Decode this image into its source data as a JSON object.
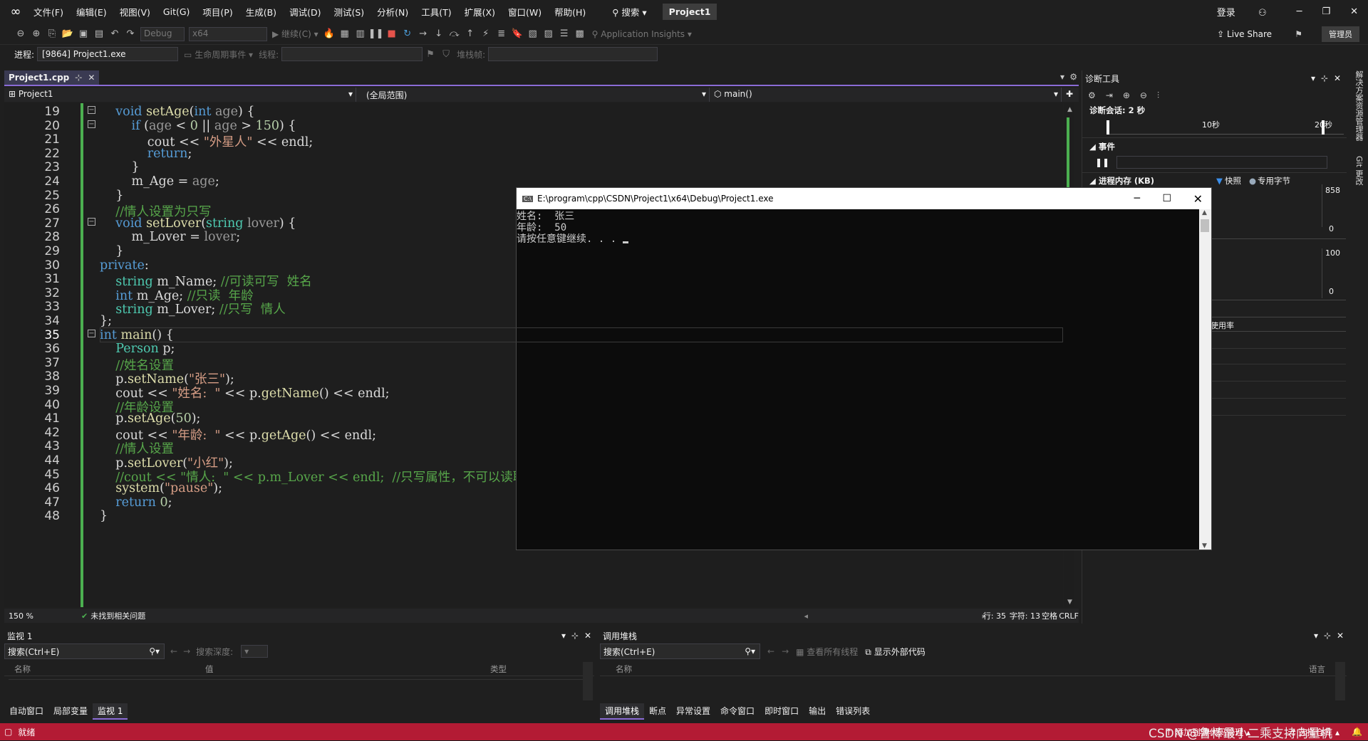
{
  "menubar": {
    "items": [
      "文件(F)",
      "编辑(E)",
      "视图(V)",
      "Git(G)",
      "项目(P)",
      "生成(B)",
      "调试(D)",
      "测试(S)",
      "分析(N)",
      "工具(T)",
      "扩展(X)",
      "窗口(W)",
      "帮助(H)"
    ],
    "search": "搜索",
    "project": "Project1",
    "signin": "登录",
    "admin": "管理员",
    "liveshare": "Live Share"
  },
  "toolbar": {
    "config": "Debug",
    "platform": "x64",
    "continue": "继续(C)",
    "insights": "Application Insights",
    "process_label": "进程:",
    "process_value": "[9864] Project1.exe",
    "lifecycle": "生命周期事件",
    "thread_label": "线程:",
    "stackframe_label": "堆栈帧:"
  },
  "editor": {
    "tab": "Project1.cpp",
    "nav_project": "Project1",
    "nav_scope": "(全局范围)",
    "nav_member": "main()",
    "zoom": "150 %",
    "issues": "未找到相关问题",
    "line_info": "行: 35",
    "char_info": "字符: 13",
    "spaces": "空格",
    "eol": "CRLF",
    "lines": [
      {
        "n": "19",
        "t": "    void setAge(int age) {"
      },
      {
        "n": "20",
        "t": "        if (age < 0 || age > 150) {"
      },
      {
        "n": "21",
        "t": "            cout << \"外星人\" << endl;"
      },
      {
        "n": "22",
        "t": "            return;"
      },
      {
        "n": "23",
        "t": "        }"
      },
      {
        "n": "24",
        "t": "        m_Age = age;"
      },
      {
        "n": "25",
        "t": "    }"
      },
      {
        "n": "26",
        "t": "    //情人设置为只写"
      },
      {
        "n": "27",
        "t": "    void setLover(string lover) {"
      },
      {
        "n": "28",
        "t": "        m_Lover = lover;"
      },
      {
        "n": "29",
        "t": "    }"
      },
      {
        "n": "30",
        "t": "private:"
      },
      {
        "n": "31",
        "t": "    string m_Name; //可读可写  姓名"
      },
      {
        "n": "32",
        "t": "    int m_Age; //只读  年龄"
      },
      {
        "n": "33",
        "t": "    string m_Lover; //只写  情人"
      },
      {
        "n": "34",
        "t": "};"
      },
      {
        "n": "35",
        "t": "int main() {"
      },
      {
        "n": "36",
        "t": "    Person p;"
      },
      {
        "n": "37",
        "t": "    //姓名设置"
      },
      {
        "n": "38",
        "t": "    p.setName(\"张三\");"
      },
      {
        "n": "39",
        "t": "    cout << \"姓名:  \" << p.getName() << endl;"
      },
      {
        "n": "40",
        "t": "    //年龄设置"
      },
      {
        "n": "41",
        "t": "    p.setAge(50);"
      },
      {
        "n": "42",
        "t": "    cout << \"年龄:  \" << p.getAge() << endl;"
      },
      {
        "n": "43",
        "t": "    //情人设置"
      },
      {
        "n": "44",
        "t": "    p.setLover(\"小红\");"
      },
      {
        "n": "45",
        "t": "    //cout << \"情人:  \" << p.m_Lover << endl;  //只写属性，不可以读取"
      },
      {
        "n": "46",
        "t": "    system(\"pause\");"
      },
      {
        "n": "47",
        "t": "    return 0;"
      },
      {
        "n": "48",
        "t": "}"
      }
    ]
  },
  "console": {
    "title": "E:\\program\\cpp\\CSDN\\Project1\\x64\\Debug\\Project1.exe",
    "output": "姓名:  张三\n年龄:  50\n请按任意键继续. . . "
  },
  "diag": {
    "title": "诊断工具",
    "session": "诊断会话: 2 秒",
    "tick1": "10秒",
    "tick2": "20秒",
    "events": "事件",
    "memory": "进程内存 (KB)",
    "snapshot": "快照",
    "private_bytes": "专用字节",
    "mem_max": "858",
    "mem_min": "0",
    "cpu_max": "100",
    "cpu_min": "0",
    "cpu_usage": "使用率"
  },
  "watch": {
    "title": "监视 1",
    "search": "搜索(Ctrl+E)",
    "depth": "搜索深度:",
    "col_name": "名称",
    "col_value": "值",
    "col_type": "类型",
    "tabs": [
      "自动窗口",
      "局部变量",
      "监视 1"
    ]
  },
  "callstack": {
    "title": "调用堆栈",
    "search": "搜索(Ctrl+E)",
    "view_threads": "查看所有线程",
    "external": "显示外部代码",
    "col_name": "名称",
    "col_lang": "语言",
    "tabs": [
      "调用堆栈",
      "断点",
      "异常设置",
      "命令窗口",
      "即时窗口",
      "输出",
      "错误列表"
    ]
  },
  "statusbar": {
    "ready": "就绪",
    "source_control": "添加到源代码管理",
    "select_repo": "选择仓库",
    "watermark": "CSDN @鲁棒最小二乘支持向量机"
  },
  "rightstrip": {
    "solution": "解决方案资源管理器",
    "git": "Git 更改"
  }
}
